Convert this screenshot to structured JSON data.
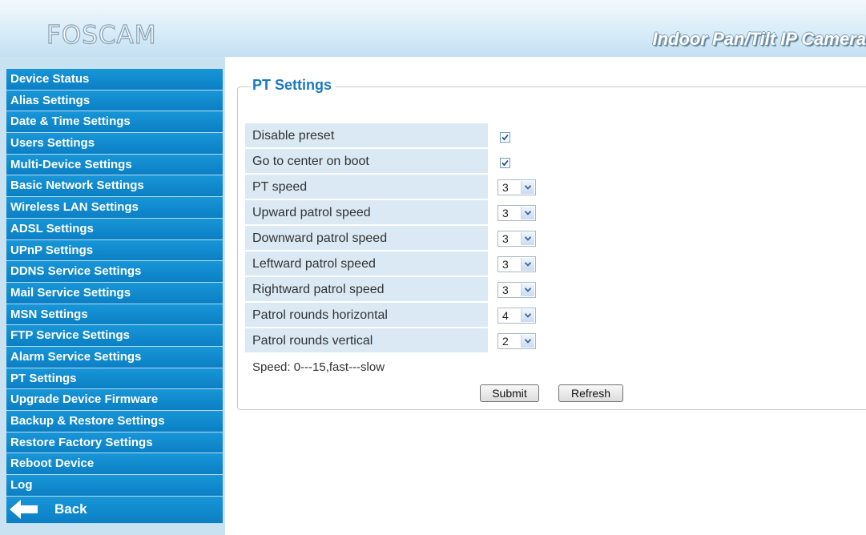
{
  "header": {
    "logo": "FOSCAM",
    "product": "Indoor Pan/Tilt IP Camera"
  },
  "sidebar": {
    "items": [
      "Device Status",
      "Alias Settings",
      "Date & Time Settings",
      "Users Settings",
      "Multi-Device Settings",
      "Basic Network Settings",
      "Wireless LAN Settings",
      "ADSL Settings",
      "UPnP Settings",
      "DDNS Service Settings",
      "Mail Service Settings",
      "MSN Settings",
      "FTP Service Settings",
      "Alarm Service Settings",
      "PT Settings",
      "Upgrade Device Firmware",
      "Backup & Restore Settings",
      "Restore Factory Settings",
      "Reboot Device",
      "Log"
    ],
    "back_label": "Back"
  },
  "pt": {
    "title": "PT Settings",
    "rows": [
      {
        "label": "Disable preset",
        "type": "checkbox",
        "checked": true
      },
      {
        "label": "Go to center on boot",
        "type": "checkbox",
        "checked": true
      },
      {
        "label": "PT speed",
        "type": "select",
        "value": "3"
      },
      {
        "label": "Upward patrol speed",
        "type": "select",
        "value": "3"
      },
      {
        "label": "Downward patrol speed",
        "type": "select",
        "value": "3"
      },
      {
        "label": "Leftward patrol speed",
        "type": "select",
        "value": "3"
      },
      {
        "label": "Rightward patrol speed",
        "type": "select",
        "value": "3"
      },
      {
        "label": "Patrol rounds horizontal",
        "type": "select",
        "value": "4"
      },
      {
        "label": "Patrol rounds vertical",
        "type": "select",
        "value": "2"
      }
    ],
    "hint": "Speed: 0---15,fast---slow",
    "submit_label": "Submit",
    "refresh_label": "Refresh"
  },
  "colors": {
    "menu_blue": "#0c7fc4",
    "sidebar_bg": "#c9e2f2",
    "label_bg": "#dae9f4",
    "title_blue": "#1a78c2"
  }
}
